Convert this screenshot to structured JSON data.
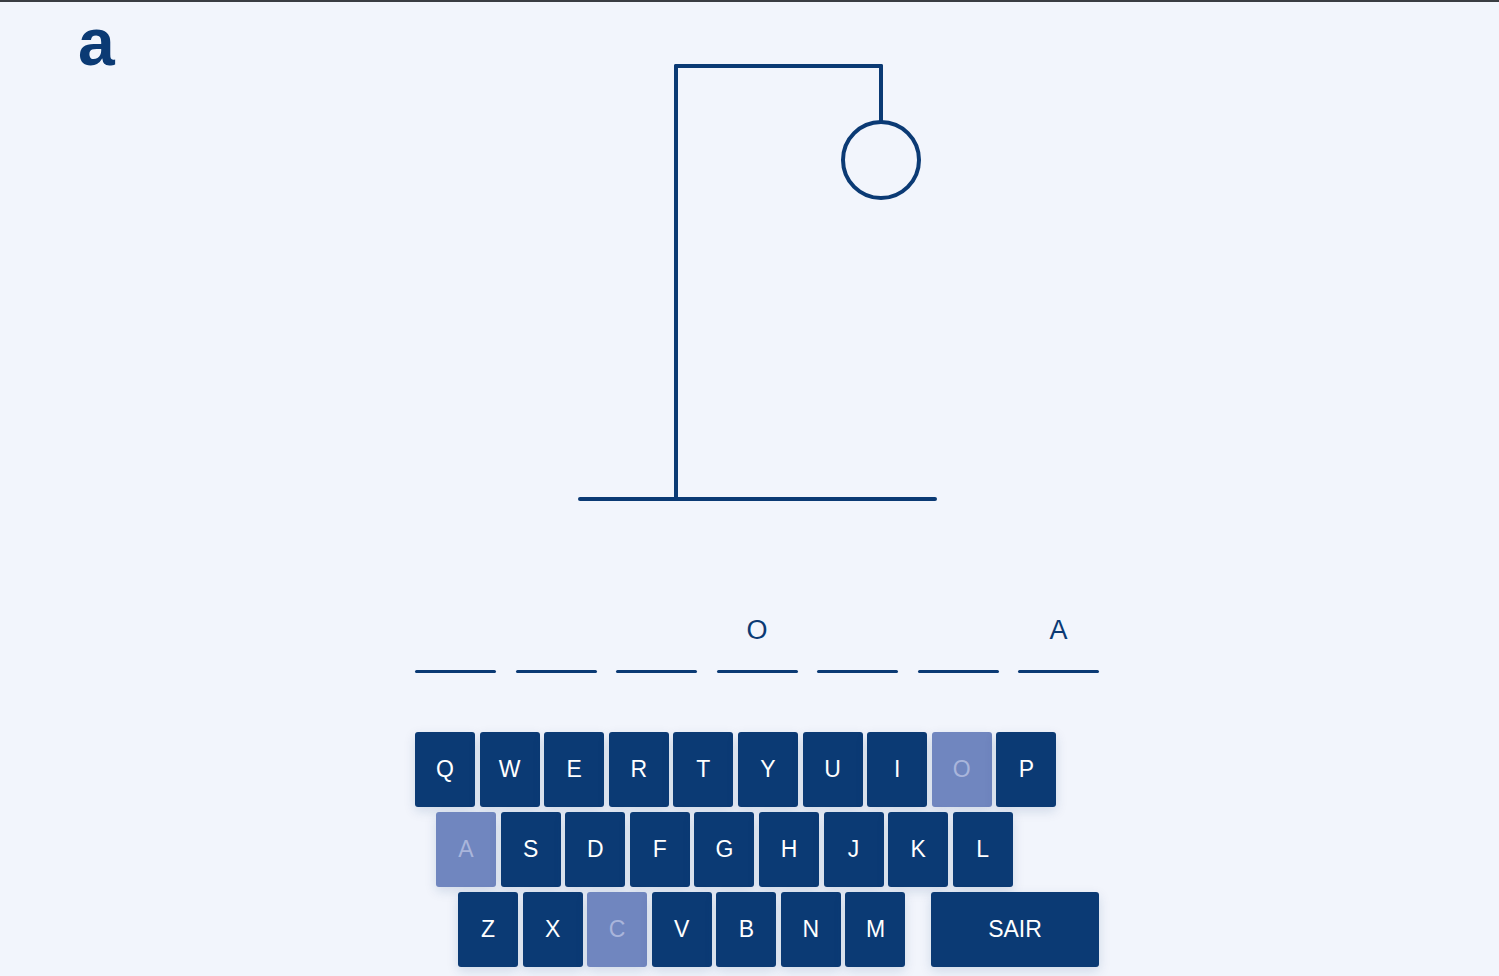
{
  "logo": "a",
  "hangman": {
    "wrong_guesses": 1
  },
  "word": {
    "slots": [
      {
        "letter": ""
      },
      {
        "letter": ""
      },
      {
        "letter": ""
      },
      {
        "letter": "O"
      },
      {
        "letter": ""
      },
      {
        "letter": ""
      },
      {
        "letter": "A"
      }
    ]
  },
  "keyboard": {
    "rows": [
      [
        {
          "label": "Q",
          "used": false
        },
        {
          "label": "W",
          "used": false
        },
        {
          "label": "E",
          "used": false
        },
        {
          "label": "R",
          "used": false
        },
        {
          "label": "T",
          "used": false
        },
        {
          "label": "Y",
          "used": false
        },
        {
          "label": "U",
          "used": false
        },
        {
          "label": "I",
          "used": false
        },
        {
          "label": "O",
          "used": true
        },
        {
          "label": "P",
          "used": false
        }
      ],
      [
        {
          "label": "A",
          "used": true
        },
        {
          "label": "S",
          "used": false
        },
        {
          "label": "D",
          "used": false
        },
        {
          "label": "F",
          "used": false
        },
        {
          "label": "G",
          "used": false
        },
        {
          "label": "H",
          "used": false
        },
        {
          "label": "J",
          "used": false
        },
        {
          "label": "K",
          "used": false
        },
        {
          "label": "L",
          "used": false
        }
      ],
      [
        {
          "label": "Z",
          "used": false
        },
        {
          "label": "X",
          "used": false
        },
        {
          "label": "C",
          "used": true
        },
        {
          "label": "V",
          "used": false
        },
        {
          "label": "B",
          "used": false
        },
        {
          "label": "N",
          "used": false
        },
        {
          "label": "M",
          "used": false
        }
      ]
    ]
  },
  "exit_button": "SAIR"
}
